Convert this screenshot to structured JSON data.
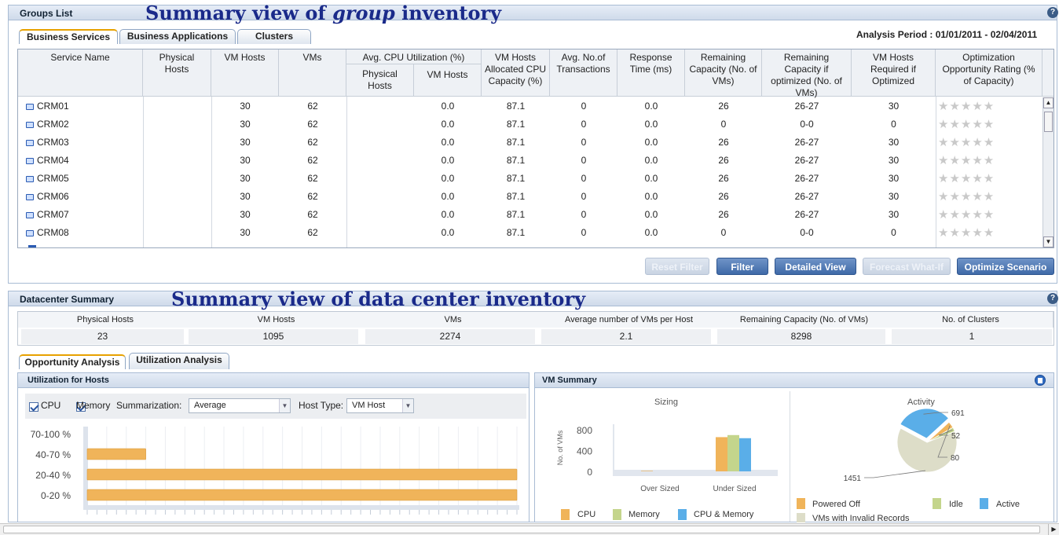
{
  "groups_panel": {
    "title": "Groups List",
    "annotation_prefix": "Summary view of",
    "annotation_italic": "group",
    "annotation_suffix": "inventory",
    "help": "?",
    "analysis_period": "Analysis Period : 01/01/2011 - 02/04/2011",
    "tabs": [
      {
        "label": "Business Services",
        "active": true
      },
      {
        "label": "Business Applications",
        "active": false
      },
      {
        "label": "Clusters",
        "active": false
      }
    ],
    "columns": {
      "service_name": "Service Name",
      "physical_hosts": "Physical Hosts",
      "vm_hosts": "VM Hosts",
      "vms": "VMs",
      "avg_cpu": "Avg. CPU Utilization (%)",
      "avg_cpu_physical": "Physical Hosts",
      "avg_cpu_vm": "VM Hosts",
      "alloc_cpu": "VM Hosts Allocated CPU Capacity (%)",
      "avg_tx": "Avg. No.of Transactions",
      "response": "Response Time (ms)",
      "remaining": "Remaining Capacity (No. of VMs)",
      "remaining_opt": "Remaining Capacity if optimized (No. of VMs)",
      "required": "VM Hosts Required if Optimized",
      "rating": "Optimization Opportunity Rating (% of Capacity)"
    },
    "rows": [
      {
        "name": "CRM01",
        "physical": "",
        "vmhosts": "30",
        "vms": "62",
        "cpu_phys": "",
        "cpu_vm": "0.0",
        "alloc": "87.1",
        "tx": "0",
        "resp": "0.0",
        "remaining": "26",
        "remaining_opt": "26-27",
        "required": "30",
        "stars": "★★★★★"
      },
      {
        "name": "CRM02",
        "physical": "",
        "vmhosts": "30",
        "vms": "62",
        "cpu_phys": "",
        "cpu_vm": "0.0",
        "alloc": "87.1",
        "tx": "0",
        "resp": "0.0",
        "remaining": "0",
        "remaining_opt": "0-0",
        "required": "0",
        "stars": "★★★★★"
      },
      {
        "name": "CRM03",
        "physical": "",
        "vmhosts": "30",
        "vms": "62",
        "cpu_phys": "",
        "cpu_vm": "0.0",
        "alloc": "87.1",
        "tx": "0",
        "resp": "0.0",
        "remaining": "26",
        "remaining_opt": "26-27",
        "required": "30",
        "stars": "★★★★★"
      },
      {
        "name": "CRM04",
        "physical": "",
        "vmhosts": "30",
        "vms": "62",
        "cpu_phys": "",
        "cpu_vm": "0.0",
        "alloc": "87.1",
        "tx": "0",
        "resp": "0.0",
        "remaining": "26",
        "remaining_opt": "26-27",
        "required": "30",
        "stars": "★★★★★"
      },
      {
        "name": "CRM05",
        "physical": "",
        "vmhosts": "30",
        "vms": "62",
        "cpu_phys": "",
        "cpu_vm": "0.0",
        "alloc": "87.1",
        "tx": "0",
        "resp": "0.0",
        "remaining": "26",
        "remaining_opt": "26-27",
        "required": "30",
        "stars": "★★★★★"
      },
      {
        "name": "CRM06",
        "physical": "",
        "vmhosts": "30",
        "vms": "62",
        "cpu_phys": "",
        "cpu_vm": "0.0",
        "alloc": "87.1",
        "tx": "0",
        "resp": "0.0",
        "remaining": "26",
        "remaining_opt": "26-27",
        "required": "30",
        "stars": "★★★★★"
      },
      {
        "name": "CRM07",
        "physical": "",
        "vmhosts": "30",
        "vms": "62",
        "cpu_phys": "",
        "cpu_vm": "0.0",
        "alloc": "87.1",
        "tx": "0",
        "resp": "0.0",
        "remaining": "26",
        "remaining_opt": "26-27",
        "required": "30",
        "stars": "★★★★★"
      },
      {
        "name": "CRM08",
        "physical": "",
        "vmhosts": "30",
        "vms": "62",
        "cpu_phys": "",
        "cpu_vm": "0.0",
        "alloc": "87.1",
        "tx": "0",
        "resp": "0.0",
        "remaining": "0",
        "remaining_opt": "0-0",
        "required": "0",
        "stars": "★★★★★"
      }
    ],
    "buttons": {
      "reset_filter": "Reset Filter",
      "filter": "Filter",
      "detailed_view": "Detailed View",
      "forecast": "Forecast What-If",
      "optimize": "Optimize Scenario"
    }
  },
  "datacenter_panel": {
    "title": "Datacenter Summary",
    "annotation": "Summary view of data center inventory",
    "help": "?",
    "summary": [
      {
        "label": "Physical Hosts",
        "value": "23"
      },
      {
        "label": "VM Hosts",
        "value": "1095"
      },
      {
        "label": "VMs",
        "value": "2274"
      },
      {
        "label": "Average number of VMs per Host",
        "value": "2.1"
      },
      {
        "label": "Remaining Capacity (No. of VMs)",
        "value": "8298"
      },
      {
        "label": "No. of Clusters",
        "value": "1"
      }
    ],
    "tabs": [
      {
        "label": "Opportunity Analysis",
        "active": true
      },
      {
        "label": "Utilization Analysis",
        "active": false
      }
    ]
  },
  "utilization": {
    "title": "Utilization for Hosts",
    "cpu_label": "CPU",
    "memory_label": "Memory",
    "summarization_label": "Summarization:",
    "summarization_value": "Average",
    "host_type_label": "Host Type:",
    "host_type_value": "VM Host"
  },
  "vm_summary": {
    "title": "VM Summary",
    "sizing_title": "Sizing",
    "activity_title": "Activity",
    "sizing_ylabel": "No. of VMs",
    "legend_sizing": [
      "CPU",
      "Memory",
      "CPU & Memory"
    ],
    "legend_activity": [
      "Powered Off",
      "Idle",
      "Active",
      "VMs with Invalid Records"
    ]
  },
  "colors": {
    "accent": "#e7a100",
    "bar": "#f0b45a",
    "cpu": "#f0b45a",
    "memory": "#c4d58c",
    "cpu_memory": "#5aaee8",
    "invalid": "#ddddc8",
    "annotation": "#1a2a8a"
  },
  "chart_data": [
    {
      "type": "bar",
      "orientation": "horizontal",
      "categories": [
        "70-100 %",
        "40-70 %",
        "20-40 %",
        "0-20 %"
      ],
      "values": [
        0,
        3,
        22,
        22
      ],
      "xlim": [
        0,
        22
      ],
      "grid": true
    },
    {
      "type": "bar",
      "title": "Sizing",
      "categories": [
        "Over Sized",
        "Under Sized"
      ],
      "ylabel": "No. of VMs",
      "ylim": [
        0,
        1000
      ],
      "yticks": [
        0,
        400,
        800
      ],
      "series": [
        {
          "name": "CPU",
          "values": [
            10,
            660
          ]
        },
        {
          "name": "Memory",
          "values": [
            0,
            700
          ]
        },
        {
          "name": "CPU & Memory",
          "values": [
            0,
            640
          ]
        }
      ],
      "legend": "bottom"
    },
    {
      "type": "pie",
      "title": "Activity",
      "labels": [
        "VMs with Invalid Records",
        "Active",
        "Powered Off",
        "Idle"
      ],
      "values": [
        1451,
        691,
        80,
        52
      ],
      "data_labels": [
        "1451",
        "691",
        "80",
        "52"
      ],
      "legend": "bottom"
    }
  ]
}
